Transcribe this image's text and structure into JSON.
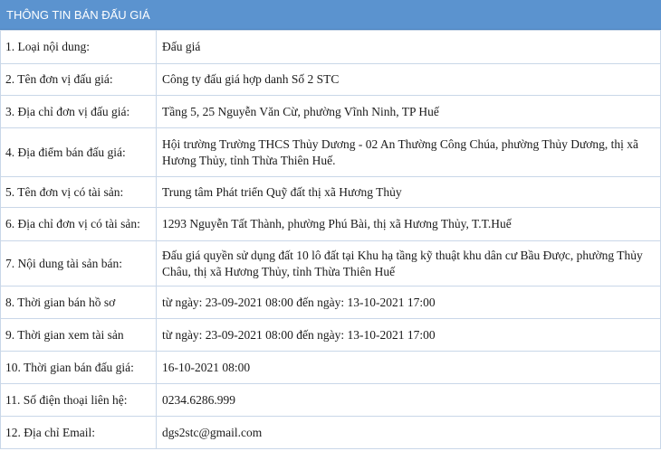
{
  "header": {
    "title": "THÔNG TIN BÁN ĐẤU GIÁ"
  },
  "rows": [
    {
      "label": "1. Loại nội dung:",
      "value": "Đấu giá"
    },
    {
      "label": "2. Tên đơn vị đấu giá:",
      "value": "Công ty đấu giá hợp danh Số 2 STC"
    },
    {
      "label": "3. Địa chỉ đơn vị đấu giá:",
      "value": "Tầng 5, 25 Nguyễn Văn Cừ, phường Vĩnh Ninh, TP Huế"
    },
    {
      "label": "4. Địa điểm bán đấu giá:",
      "value": "Hội trường Trường THCS Thủy Dương - 02 An Thường Công Chúa, phường Thủy Dương, thị xã Hương Thủy, tỉnh Thừa Thiên Huế."
    },
    {
      "label": "5. Tên đơn vị có tài sản:",
      "value": "Trung tâm Phát triển Quỹ đất thị xã Hương Thủy"
    },
    {
      "label": "6. Địa chỉ đơn vị có tài sản:",
      "value": "1293 Nguyễn Tất Thành, phường Phú Bài, thị xã Hương Thủy, T.T.Huế"
    },
    {
      "label": "7. Nội dung tài sản bán:",
      "value": "Đấu giá quyền sử dụng đất 10 lô đất tại Khu hạ tầng kỹ thuật khu dân cư Bầu Được, phường Thủy Châu, thị xã Hương Thủy, tỉnh Thừa Thiên Huế"
    },
    {
      "label": "8. Thời gian bán hồ sơ",
      "value": "từ ngày: 23-09-2021 08:00 đến ngày: 13-10-2021 17:00"
    },
    {
      "label": "9. Thời gian xem tài sản",
      "value": "từ ngày: 23-09-2021 08:00 đến ngày: 13-10-2021 17:00"
    },
    {
      "label": "10. Thời gian bán đấu giá:",
      "value": "16-10-2021 08:00"
    },
    {
      "label": "11. Số điện thoại liên hệ:",
      "value": "0234.6286.999"
    },
    {
      "label": "12. Địa chỉ Email:",
      "value": "dgs2stc@gmail.com"
    }
  ]
}
